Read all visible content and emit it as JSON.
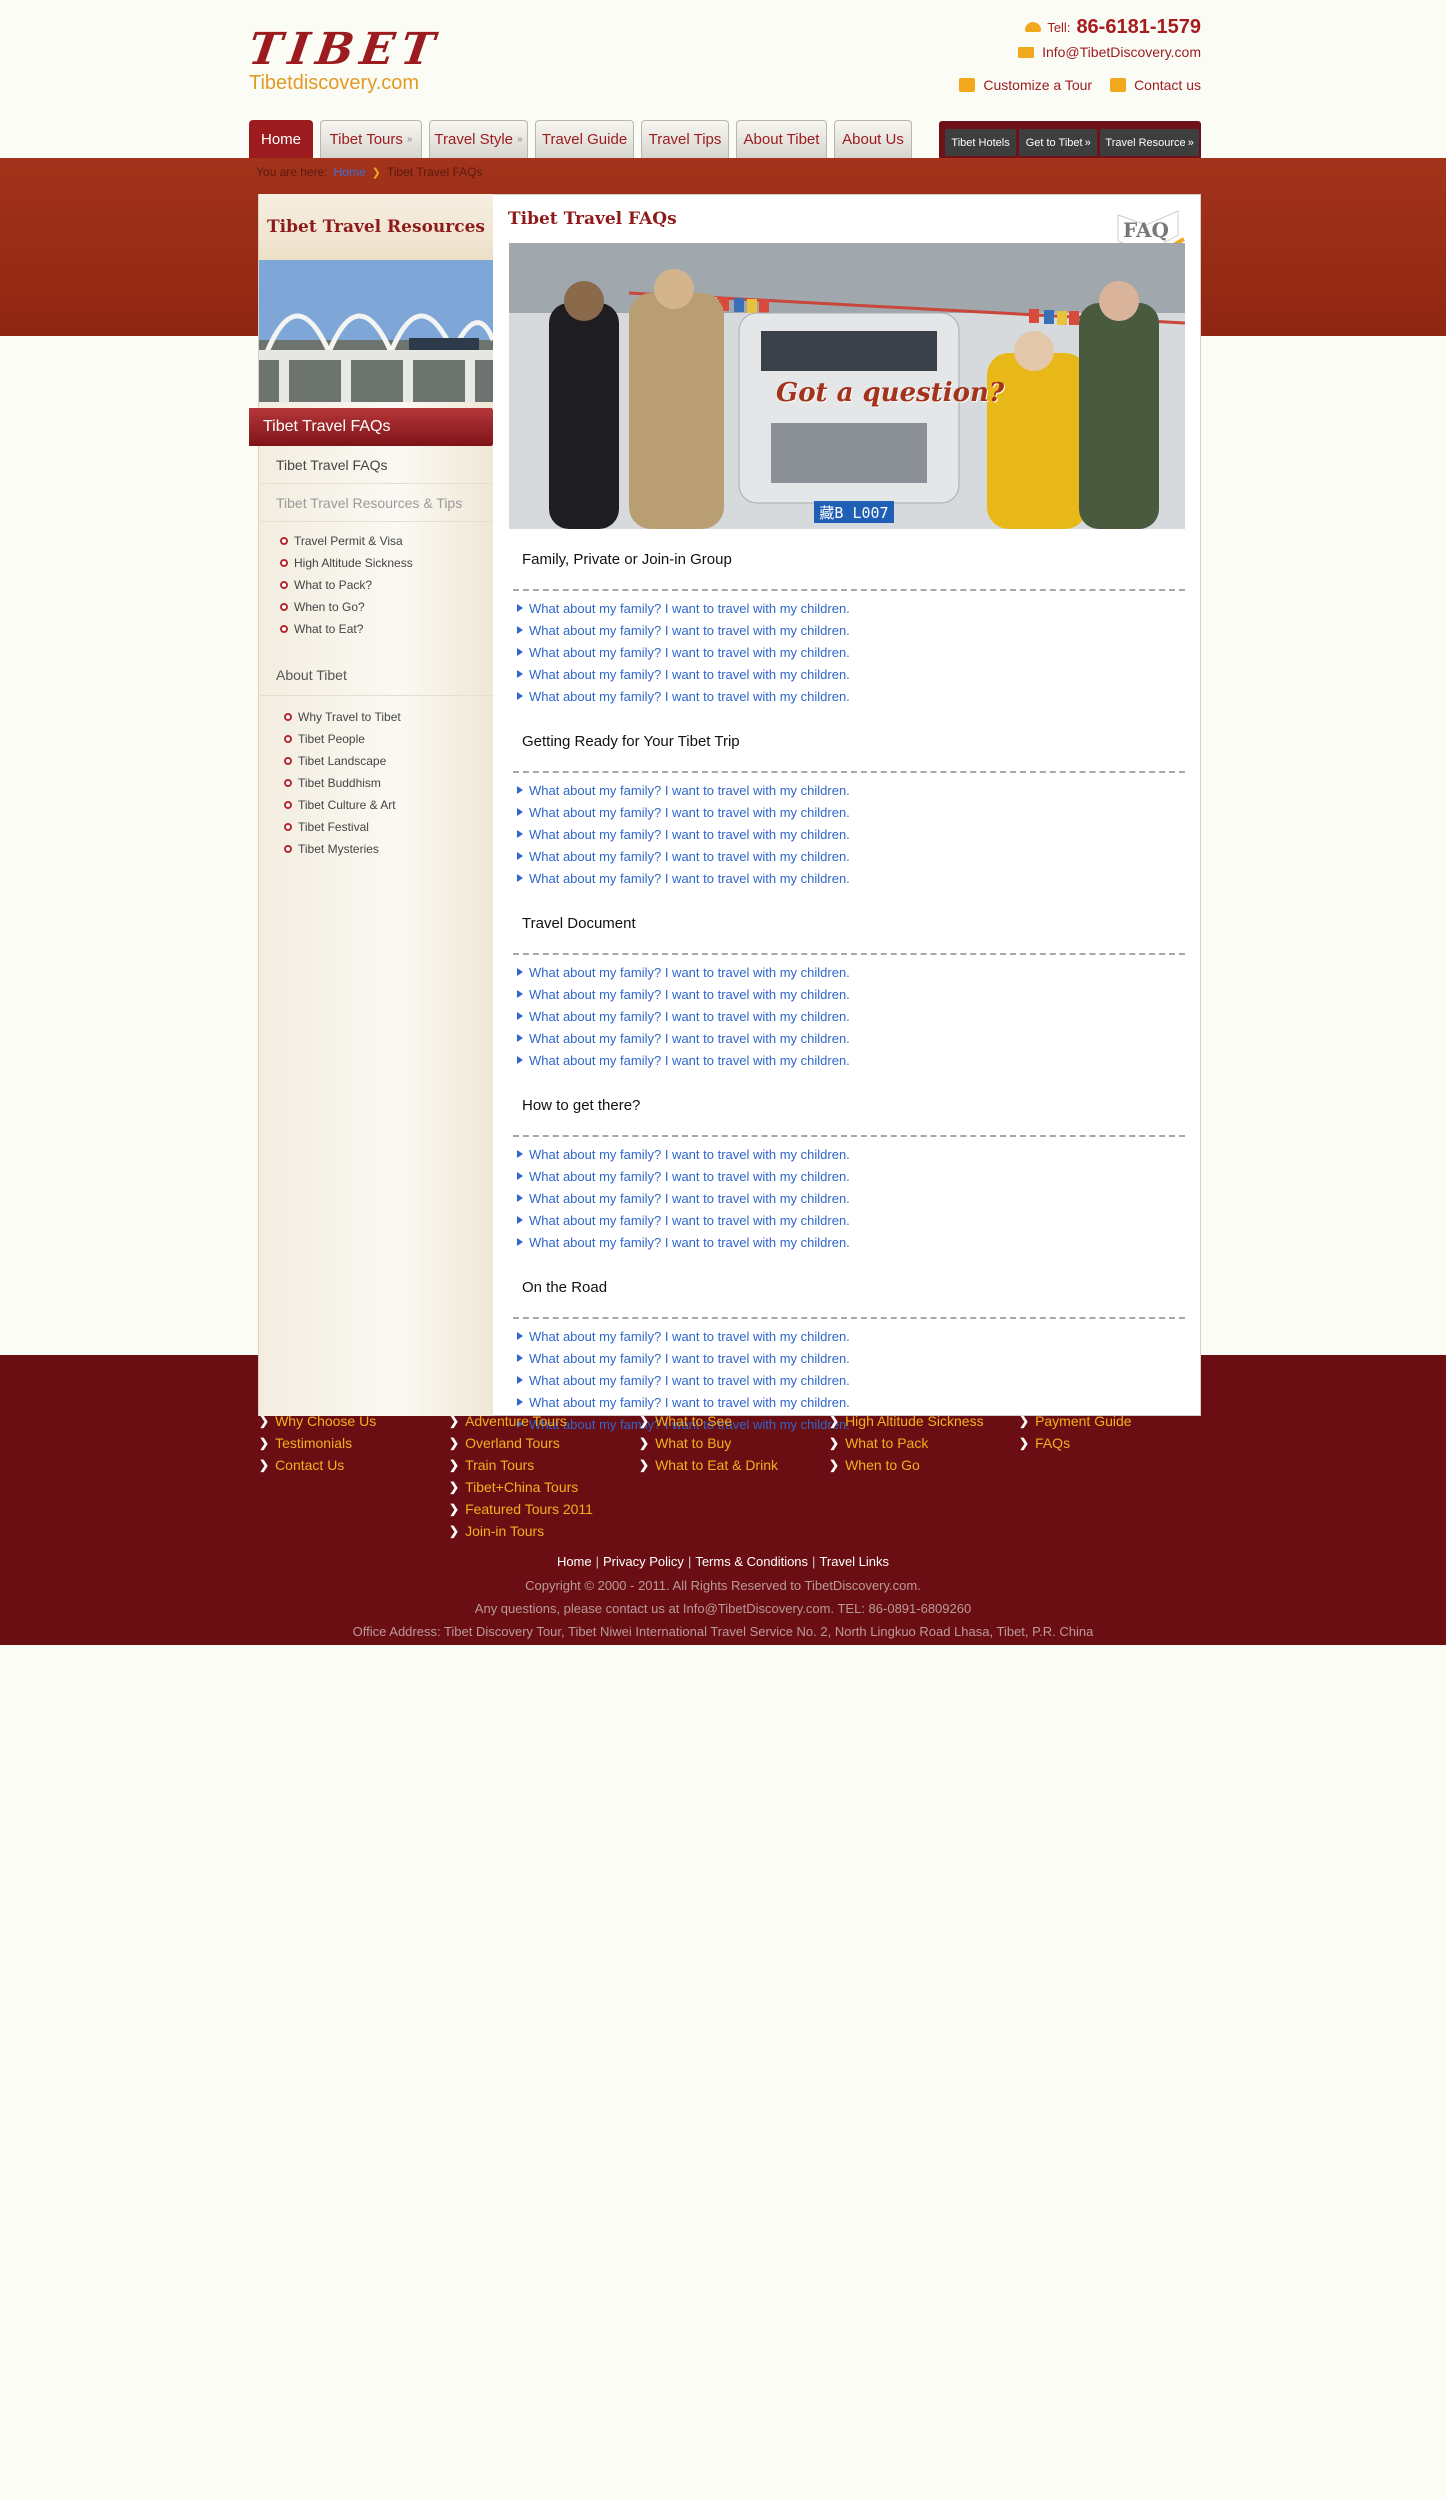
{
  "header": {
    "logo_main": "TIBET",
    "logo_sub": "Tibetdiscovery.com",
    "tel_label": "Tell:",
    "tel_number": "86-6181-1579",
    "email": "Info@TibetDiscovery.com",
    "customize_label": "Customize a Tour",
    "contact_label": "Contact us"
  },
  "nav": {
    "tabs": [
      {
        "label": "Home",
        "active": true
      },
      {
        "label": "Tibet Tours",
        "chevron": true
      },
      {
        "label": "Travel Style",
        "chevron": true
      },
      {
        "label": "Travel Guide"
      },
      {
        "label": "Travel Tips"
      },
      {
        "label": "About Tibet"
      },
      {
        "label": "About Us"
      }
    ],
    "subnav": [
      "Tibet Hotels",
      "Get to Tibet",
      "Travel Resource"
    ]
  },
  "breadcrumb": {
    "prefix": "You are here:",
    "home": "Home",
    "current": "Tibet Travel FAQs"
  },
  "sidebar": {
    "heading": "Tibet Travel Resources",
    "active_tab": "Tibet Travel FAQs",
    "items": [
      {
        "label": "Tibet Travel FAQs",
        "dim": false
      },
      {
        "label": "Tibet Travel Resources & Tips",
        "dim": true
      }
    ],
    "resources": [
      "Travel Permit & Visa",
      "High Altitude Sickness",
      "What to Pack?",
      "When to Go?",
      "What to Eat?"
    ],
    "about_heading": "About Tibet",
    "about_items": [
      "Why Travel to Tibet",
      "Tibet People",
      "Tibet Landscape",
      "Tibet Buddhism",
      "Tibet Culture & Art",
      "Tibet Festival",
      "Tibet Mysteries"
    ]
  },
  "main": {
    "title": "Tibet Travel FAQs",
    "badge": "FAQ",
    "banner_text": "Got a question?",
    "plate": "藏B L007",
    "sections": [
      {
        "title": "Family, Private or Join-in Group",
        "questions": [
          "What about my family? I want to travel with my children.",
          "What about my family? I want to travel with my children.",
          "What about my family? I want to travel with my children.",
          "What about my family? I want to travel with my children.",
          "What about my family? I want to travel with my children."
        ]
      },
      {
        "title": "Getting Ready for Your Tibet Trip",
        "questions": [
          "What about my family? I want to travel with my children.",
          "What about my family? I want to travel with my children.",
          "What about my family? I want to travel with my children.",
          "What about my family? I want to travel with my children.",
          "What about my family? I want to travel with my children."
        ]
      },
      {
        "title": "Travel Document",
        "questions": [
          "What about my family? I want to travel with my children.",
          "What about my family? I want to travel with my children.",
          "What about my family? I want to travel with my children.",
          "What about my family? I want to travel with my children.",
          "What about my family? I want to travel with my children."
        ]
      },
      {
        "title": "How to get there?",
        "questions": [
          "What about my family? I want to travel with my children.",
          "What about my family? I want to travel with my children.",
          "What about my family? I want to travel with my children.",
          "What about my family? I want to travel with my children.",
          "What about my family? I want to travel with my children."
        ]
      },
      {
        "title": "On the Road",
        "questions": [
          "What about my family? I want to travel with my children.",
          "What about my family? I want to travel with my children.",
          "What about my family? I want to travel with my children.",
          "What about my family? I want to travel with my children.",
          "What about my family? I want to travel with my children."
        ]
      }
    ]
  },
  "footer": {
    "columns": [
      [
        "Why Choose Us",
        "Testimonials",
        "Contact Us"
      ],
      [
        "Adventure Tours",
        "Overland Tours",
        "Train Tours",
        "Tibet+China Tours",
        "Featured Tours 2011",
        "Join-in Tours"
      ],
      [
        "What to See",
        "What to Buy",
        "What to Eat & Drink"
      ],
      [
        "High Altitude Sickness",
        "What to Pack",
        "When to Go"
      ],
      [
        "Payment Guide",
        "FAQs"
      ]
    ],
    "links": [
      "Home",
      "Privacy Policy",
      "Terms & Conditions",
      "Travel Links"
    ],
    "copyright": "Copyright © 2000 - 2011. All Rights Reserved to TibetDiscovery.com.",
    "questions": "Any questions, please contact us at Info@TibetDiscovery.com. TEL: 86-0891-6809260",
    "address": "Office Address: Tibet Discovery Tour, Tibet Niwei International Travel Service No. 2, North Lingkuo Road Lhasa, Tibet, P.R. China"
  },
  "colors": {
    "brand_red": "#9b1b1e",
    "accent_orange": "#f2a81d",
    "link_blue": "#2f66c9",
    "footer_bg": "#6b0e13"
  }
}
